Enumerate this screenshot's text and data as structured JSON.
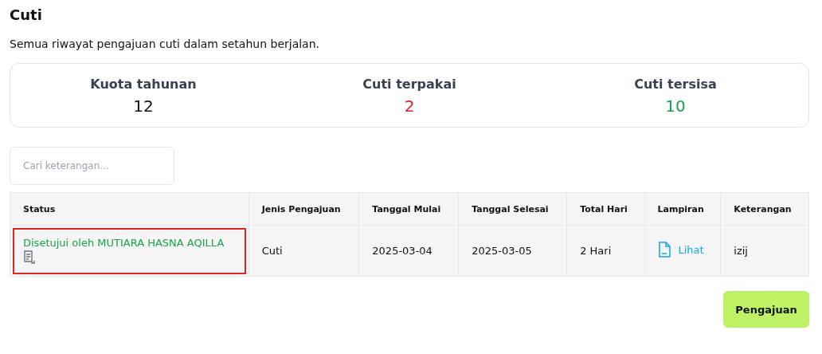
{
  "title": "Cuti",
  "subtitle": "Semua riwayat pengajuan cuti dalam setahun berjalan.",
  "stats": [
    {
      "label": "Kuota tahunan",
      "value": "12",
      "color": "#111111"
    },
    {
      "label": "Cuti terpakai",
      "value": "2",
      "color": "#e02424"
    },
    {
      "label": "Cuti tersisa",
      "value": "10",
      "color": "#16a34a"
    }
  ],
  "search": {
    "placeholder": "Cari keterangan..."
  },
  "table": {
    "columns": [
      "Status",
      "Jenis Pengajuan",
      "Tanggal Mulai",
      "Tanggal Selesai",
      "Total Hari",
      "Lampiran",
      "Keterangan"
    ],
    "rows": [
      {
        "status": "Disetujui oleh MUTIARA HASNA AQILLA",
        "highlighted": true,
        "type": "Cuti",
        "start": "2025-03-04",
        "end": "2025-03-05",
        "total": "2 Hari",
        "attachment": "Lihat",
        "note": "izij"
      }
    ]
  },
  "submit_button": "Pengajuan"
}
